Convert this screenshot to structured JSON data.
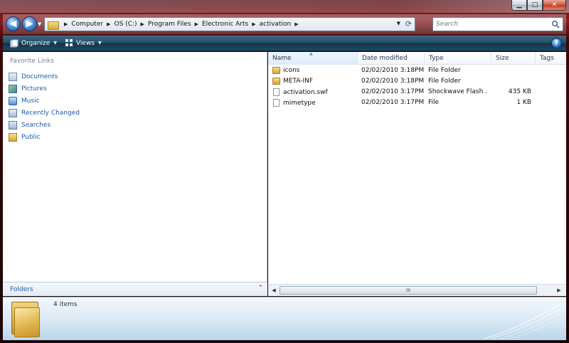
{
  "window": {
    "controls": {
      "minimize": "▁",
      "maximize": "□",
      "close": "✕"
    }
  },
  "address_bar": {
    "crumbs": [
      "Computer",
      "OS (C:)",
      "Program Files",
      "Electronic Arts",
      "activation"
    ],
    "search_placeholder": "Search"
  },
  "toolbar": {
    "organize_label": "Organize",
    "views_label": "Views",
    "help_label": "?"
  },
  "navigation": {
    "favorite_links_title": "Favorite Links",
    "items": [
      {
        "label": "Documents",
        "icon": "documents-icon"
      },
      {
        "label": "Pictures",
        "icon": "pictures-icon"
      },
      {
        "label": "Music",
        "icon": "music-icon"
      },
      {
        "label": "Recently Changed",
        "icon": "recently-changed-icon"
      },
      {
        "label": "Searches",
        "icon": "searches-icon"
      },
      {
        "label": "Public",
        "icon": "public-folder-icon"
      }
    ],
    "folders_label": "Folders"
  },
  "file_list": {
    "columns": [
      "Name",
      "Date modified",
      "Type",
      "Size",
      "Tags"
    ],
    "rows": [
      {
        "name": "icons",
        "date": "02/02/2010 3:18PM",
        "type": "File Folder",
        "size": "",
        "kind": "folder"
      },
      {
        "name": "META-INF",
        "date": "02/02/2010 3:18PM",
        "type": "File Folder",
        "size": "",
        "kind": "folder"
      },
      {
        "name": "activation.swf",
        "date": "02/02/2010 3:17PM",
        "type": "Shockwave Flash ...",
        "size": "435 KB",
        "kind": "file"
      },
      {
        "name": "mimetype",
        "date": "02/02/2010 3:17PM",
        "type": "File",
        "size": "1 KB",
        "kind": "file"
      }
    ],
    "scroll_grip": "III"
  },
  "details": {
    "item_count": "4 items"
  }
}
